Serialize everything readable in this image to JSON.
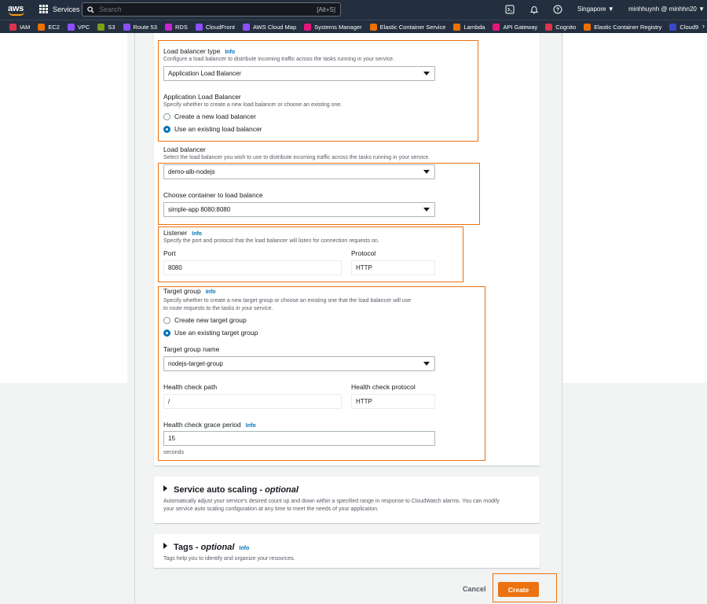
{
  "topnav": {
    "logo_text": "aws",
    "services_label": "Services",
    "search_placeholder": "Search",
    "search_shortcut": "[Alt+S]",
    "region": "Singapore ▼",
    "user": "minhhuynh @ minhhn20 ▼"
  },
  "favorites": [
    {
      "label": "IAM",
      "color": "#dd344c"
    },
    {
      "label": "EC2",
      "color": "#ed7100"
    },
    {
      "label": "VPC",
      "color": "#8c4fff"
    },
    {
      "label": "S3",
      "color": "#7aa116"
    },
    {
      "label": "Route 53",
      "color": "#8c4fff"
    },
    {
      "label": "RDS",
      "color": "#c925d1"
    },
    {
      "label": "CloudFront",
      "color": "#8c4fff"
    },
    {
      "label": "AWS Cloud Map",
      "color": "#8c4fff"
    },
    {
      "label": "Systems Manager",
      "color": "#e7157b"
    },
    {
      "label": "Elastic Container Service",
      "color": "#ed7100"
    },
    {
      "label": "Lambda",
      "color": "#ed7100"
    },
    {
      "label": "API Gateway",
      "color": "#e7157b"
    },
    {
      "label": "Cognito",
      "color": "#dd344c"
    },
    {
      "label": "Elastic Container Registry",
      "color": "#ed7100"
    },
    {
      "label": "Cloud9",
      "color": "#3b48cc"
    }
  ],
  "lb_type": {
    "label": "Load balancer type",
    "info": "Info",
    "desc": "Configure a load balancer to distribute incoming traffic across the tasks running in your service.",
    "value": "Application Load Balancer"
  },
  "alb": {
    "label": "Application Load Balancer",
    "desc": "Specify whether to create a new load balancer or choose an existing one.",
    "option_new": "Create a new load balancer",
    "option_existing": "Use an existing load balancer"
  },
  "load_balancer": {
    "label": "Load balancer",
    "desc": "Select the load balancer you wish to use to distribute incoming traffic across the tasks running in your service.",
    "value": "demo-alb-nodejs"
  },
  "container": {
    "label": "Choose container to load balance",
    "value": "simple-app 8080:8080"
  },
  "listener": {
    "label": "Listener",
    "info": "Info",
    "desc": "Specify the port and protocol that the load balancer will listen for connection requests on.",
    "port_label": "Port",
    "port_value": "8080",
    "protocol_label": "Protocol",
    "protocol_value": "HTTP"
  },
  "target_group": {
    "label": "Target group",
    "info": "Info",
    "desc1": "Specify whether to create a new target group or choose an existing one that the load balancer will use",
    "desc2": "to route requests to the tasks in your service.",
    "option_new": "Create new target group",
    "option_existing": "Use an existing target group",
    "name_label": "Target group name",
    "name_value": "nodejs-target-group",
    "hc_path_label": "Health check path",
    "hc_path_value": "/",
    "hc_protocol_label": "Health check protocol",
    "hc_protocol_value": "HTTP",
    "grace_label": "Health check grace period",
    "grace_info": "Info",
    "grace_value": "15",
    "grace_unit": "seconds"
  },
  "auto_scaling": {
    "title": "Service auto scaling - ",
    "title_optional": "optional",
    "desc1": "Automatically adjust your service's desired count up and down within a specified range in response to CloudWatch alarms. You can modify",
    "desc2": "your service auto scaling configuration at any time to meet the needs of your application."
  },
  "tags": {
    "title": "Tags - ",
    "title_optional": "optional",
    "info": "Info",
    "desc": "Tags help you to identify and organize your resources."
  },
  "actions": {
    "cancel": "Cancel",
    "create": "Create"
  }
}
